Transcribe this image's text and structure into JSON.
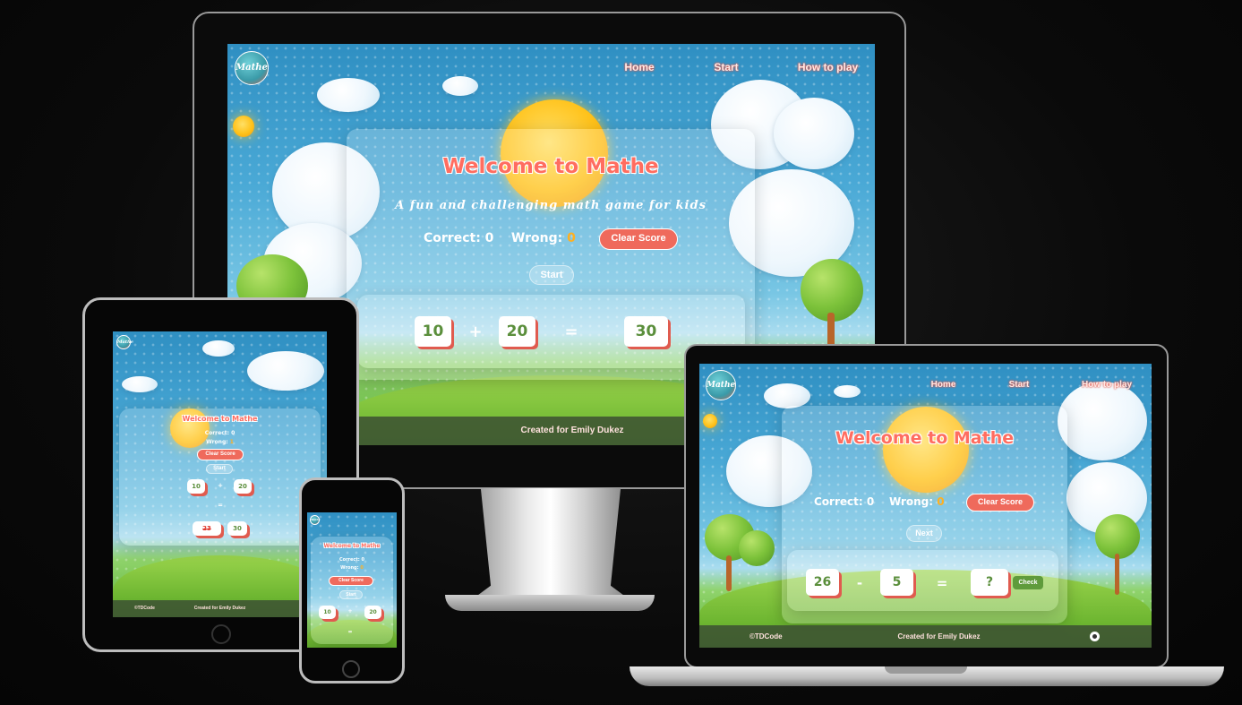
{
  "app": {
    "logo_text": "Mathe",
    "nav": {
      "home": "Home",
      "start": "Start",
      "how_to_play": "How to play"
    },
    "title": "Welcome to Mathe",
    "subtitle": "A fun and challenging math game for kids",
    "score": {
      "correct_label": "Correct:",
      "wrong_label": "Wrong:"
    },
    "clear_score_label": "Clear Score",
    "start_label": "Start",
    "next_label": "Next",
    "check_label": "Check",
    "footer": {
      "left": "©TDCode",
      "center": "Created for Emily Dukez"
    },
    "colors": {
      "accent": "#ef6a5c",
      "number": "#5b8f3c",
      "wrong": "#ffb020"
    }
  },
  "desktop": {
    "correct": "0",
    "wrong": "0",
    "equation": {
      "a": "10",
      "op": "+",
      "b": "20",
      "eq": "=",
      "answer": "30"
    }
  },
  "tablet": {
    "correct": "0",
    "wrong": "1",
    "equation": {
      "a": "10",
      "op": "+",
      "b": "20",
      "eq": "=",
      "wrong_answer": "23",
      "answer": "30"
    }
  },
  "phone": {
    "correct": "0",
    "wrong": "0",
    "equation": {
      "a": "10",
      "op": "+",
      "b": "20",
      "eq": "="
    }
  },
  "laptop": {
    "correct": "0",
    "wrong": "0",
    "equation": {
      "a": "26",
      "op": "-",
      "b": "5",
      "eq": "=",
      "answer": "?"
    }
  }
}
